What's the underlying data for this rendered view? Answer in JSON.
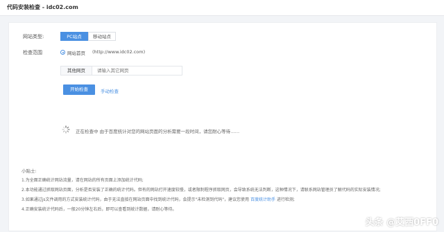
{
  "header": {
    "title": "代码安装检查 - idc02.com"
  },
  "form": {
    "site_type_label": "网站类型:",
    "site_type_options": [
      {
        "label": "PC站点",
        "selected": true
      },
      {
        "label": "移动站点",
        "selected": false
      }
    ],
    "scope_label": "检查范围",
    "homepage": {
      "label": "网站首页",
      "url": "(http://www.idc02.com)"
    },
    "other_page": {
      "label": "其他网页",
      "placeholder": "请输入其它网页"
    },
    "start_button": "开始检查",
    "manual_check": "手动检查"
  },
  "status": {
    "text": "正在检查中   由于百度统计对您的网站页面的分析需要一段时间，请您耐心等待……"
  },
  "tips": {
    "title": "小贴士:",
    "items": [
      {
        "text": "1.为全面正确统计网站流量，请在网站的所有页面上添加统计代码;"
      },
      {
        "text": "2.本功能通过抓取网站页面，分析是否安装了正确的统计代码。但有的网站打开速度较慢，或者限制程序抓取网页，会导致系统无法判断，这种情况下，请联系网站管理员了解代码的实际安装情况;"
      },
      {
        "text_before": "3.如果通过js文件调用的方式安装统计代码，由于无法直接在网站页面中找到统计代码，会提示\"未检测到代码\"，建议您使用",
        "link": "百度统计助手",
        "text_after": "进行检测;"
      },
      {
        "text": "4.正确安装统计代码后，一般20分钟左右后，即可以查看到统计数据，请耐心等待。"
      }
    ]
  },
  "watermark": "头条 @艾西0FF0",
  "colors": {
    "accent": "#4a90e2",
    "background": "#f2f4f7"
  }
}
